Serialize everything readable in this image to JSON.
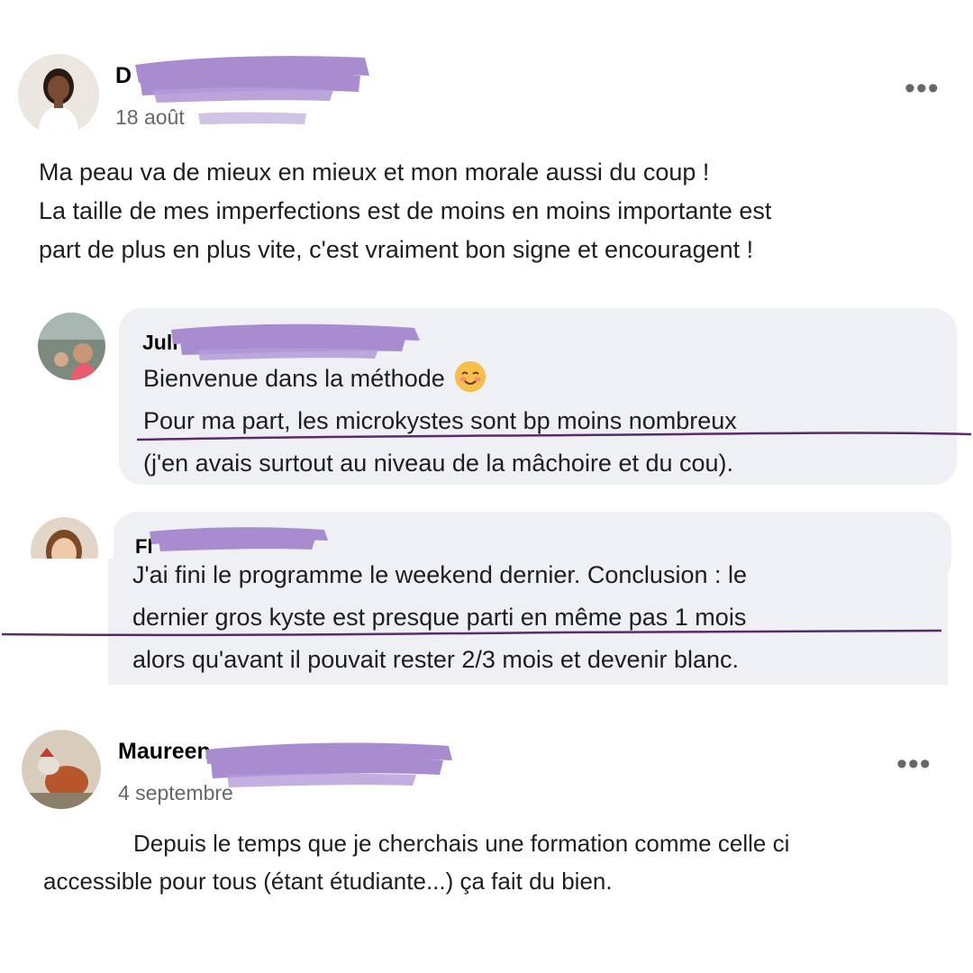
{
  "post1": {
    "author_visible": "D",
    "date": "18 août",
    "more_label": "•••",
    "text_lines": [
      "Ma peau va de mieux en mieux et mon morale aussi du coup !",
      "La taille de mes imperfections est de moins en moins importante est",
      "part de plus en plus vite, c'est vraiment bon signe et encouragent !"
    ]
  },
  "reply1": {
    "author_visible": "Juli",
    "text_lines": [
      "Bienvenue dans la méthode",
      "Pour ma part, les microkystes sont bp moins nombreux",
      "(j'en avais surtout au niveau de la mâchoire et du cou)."
    ],
    "emoji": "smiling-face-emoji"
  },
  "reply2": {
    "author_visible": "Fl",
    "text_lines": [
      "J'ai fini le programme le weekend dernier. Conclusion : le",
      "dernier gros kyste est presque parti en même pas 1 mois",
      "alors qu'avant il pouvait rester 2/3 mois et devenir blanc."
    ]
  },
  "post2": {
    "author_visible": "Maureen",
    "date": "4 septembre",
    "more_label": "•••",
    "text_lines": [
      "Depuis le temps que je cherchais une formation comme celle ci",
      "accessible pour tous (étant étudiante...) ça fait du bien."
    ]
  },
  "colors": {
    "redaction": "#a98ccf",
    "underline": "#5a2a6a",
    "bubble": "#eef0f3",
    "secondary_text": "#65676b"
  }
}
